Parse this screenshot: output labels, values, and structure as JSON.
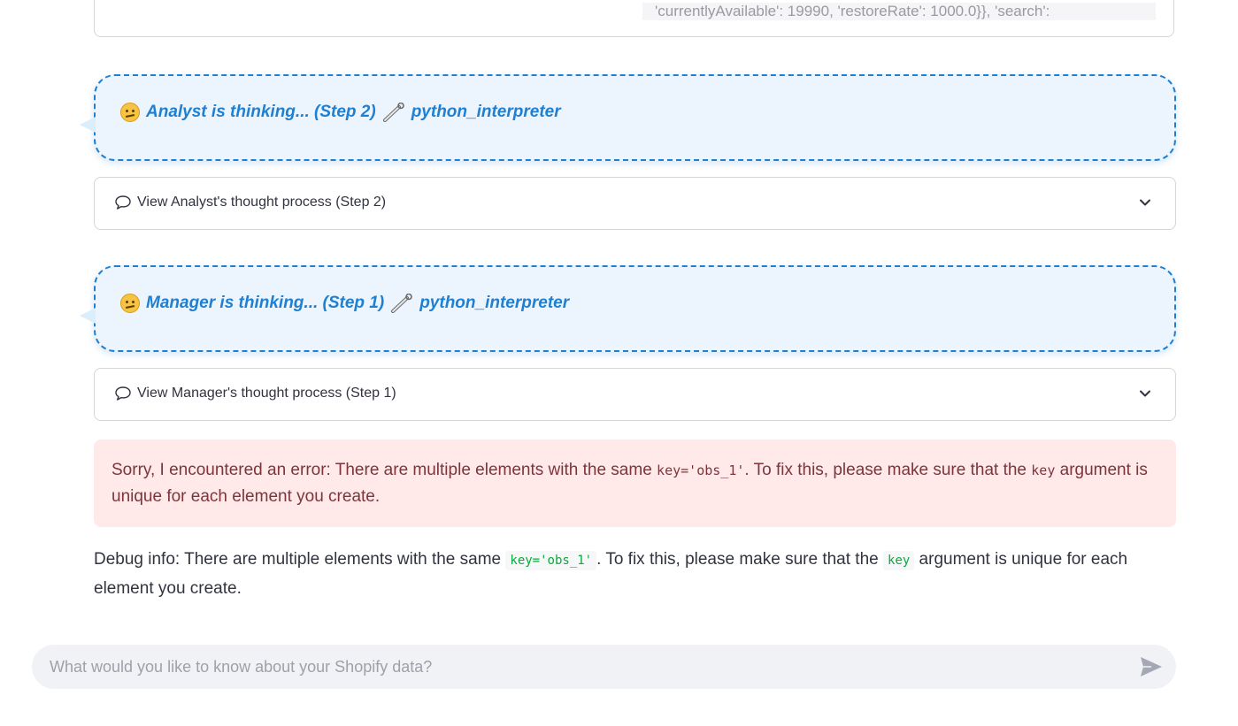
{
  "top_card": {
    "observation_text": "'currentlyAvailable': 19990, 'restoreRate': 1000.0}}, 'search': "
  },
  "bubbles": [
    {
      "prefix": "Analyst is thinking... (Step 2)",
      "tool": "python_interpreter"
    },
    {
      "prefix": "Manager is thinking... (Step 1)",
      "tool": "python_interpreter"
    }
  ],
  "expanders": [
    {
      "label": "View Analyst's thought process (Step 2)"
    },
    {
      "label": "View Manager's thought process (Step 1)"
    }
  ],
  "error": {
    "part1": "Sorry, I encountered an error: There are multiple elements with the same ",
    "code1": "key='obs_1'",
    "part2": ". To fix this, please make sure that the ",
    "code2": "key",
    "part3": " argument is unique for each element you create."
  },
  "debug": {
    "part1": "Debug info: There are multiple elements with the same ",
    "code1": "key='obs_1'",
    "part2": ". To fix this, please make sure that the ",
    "code2": "key",
    "part3": " argument is unique for each element you create."
  },
  "chat": {
    "placeholder": "What would you like to know about your Shopify data?",
    "value": ""
  },
  "icons": {
    "thinking": "thinking-face-icon",
    "tool": "wrench-icon",
    "thought": "speech-bubble-icon",
    "expand": "chevron-down-icon",
    "send": "send-icon"
  },
  "colors": {
    "accent": "#1f7fd1",
    "bubble_bg": "#ecf5fe",
    "error_bg": "#ffe9e9",
    "error_text": "#7d353b",
    "code_green": "#09ab3b"
  }
}
